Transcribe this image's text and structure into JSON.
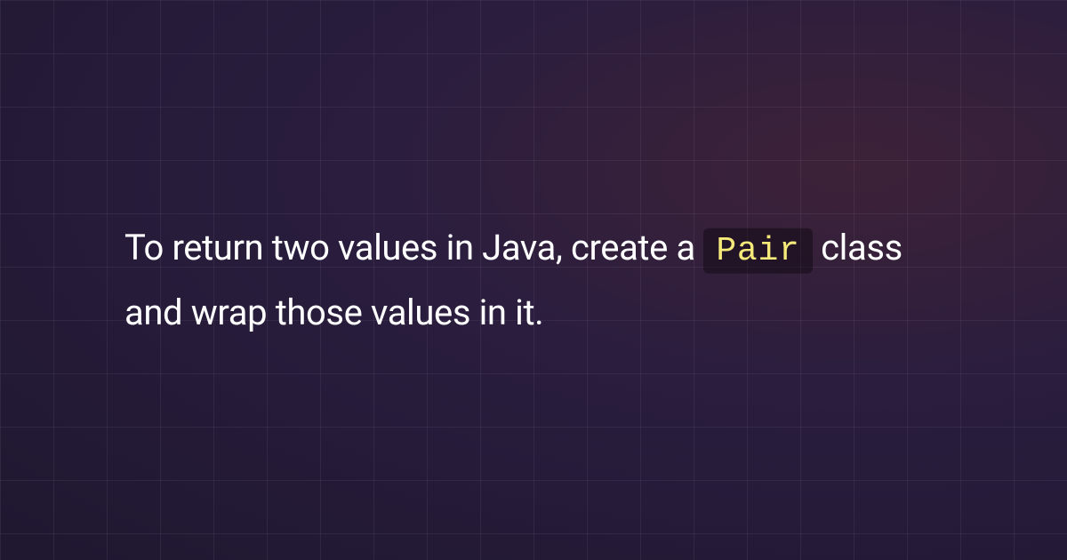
{
  "content": {
    "text_before_code": "To return two values in Java, create a ",
    "code": "Pair",
    "text_after_code": " class and wrap those values in it."
  }
}
